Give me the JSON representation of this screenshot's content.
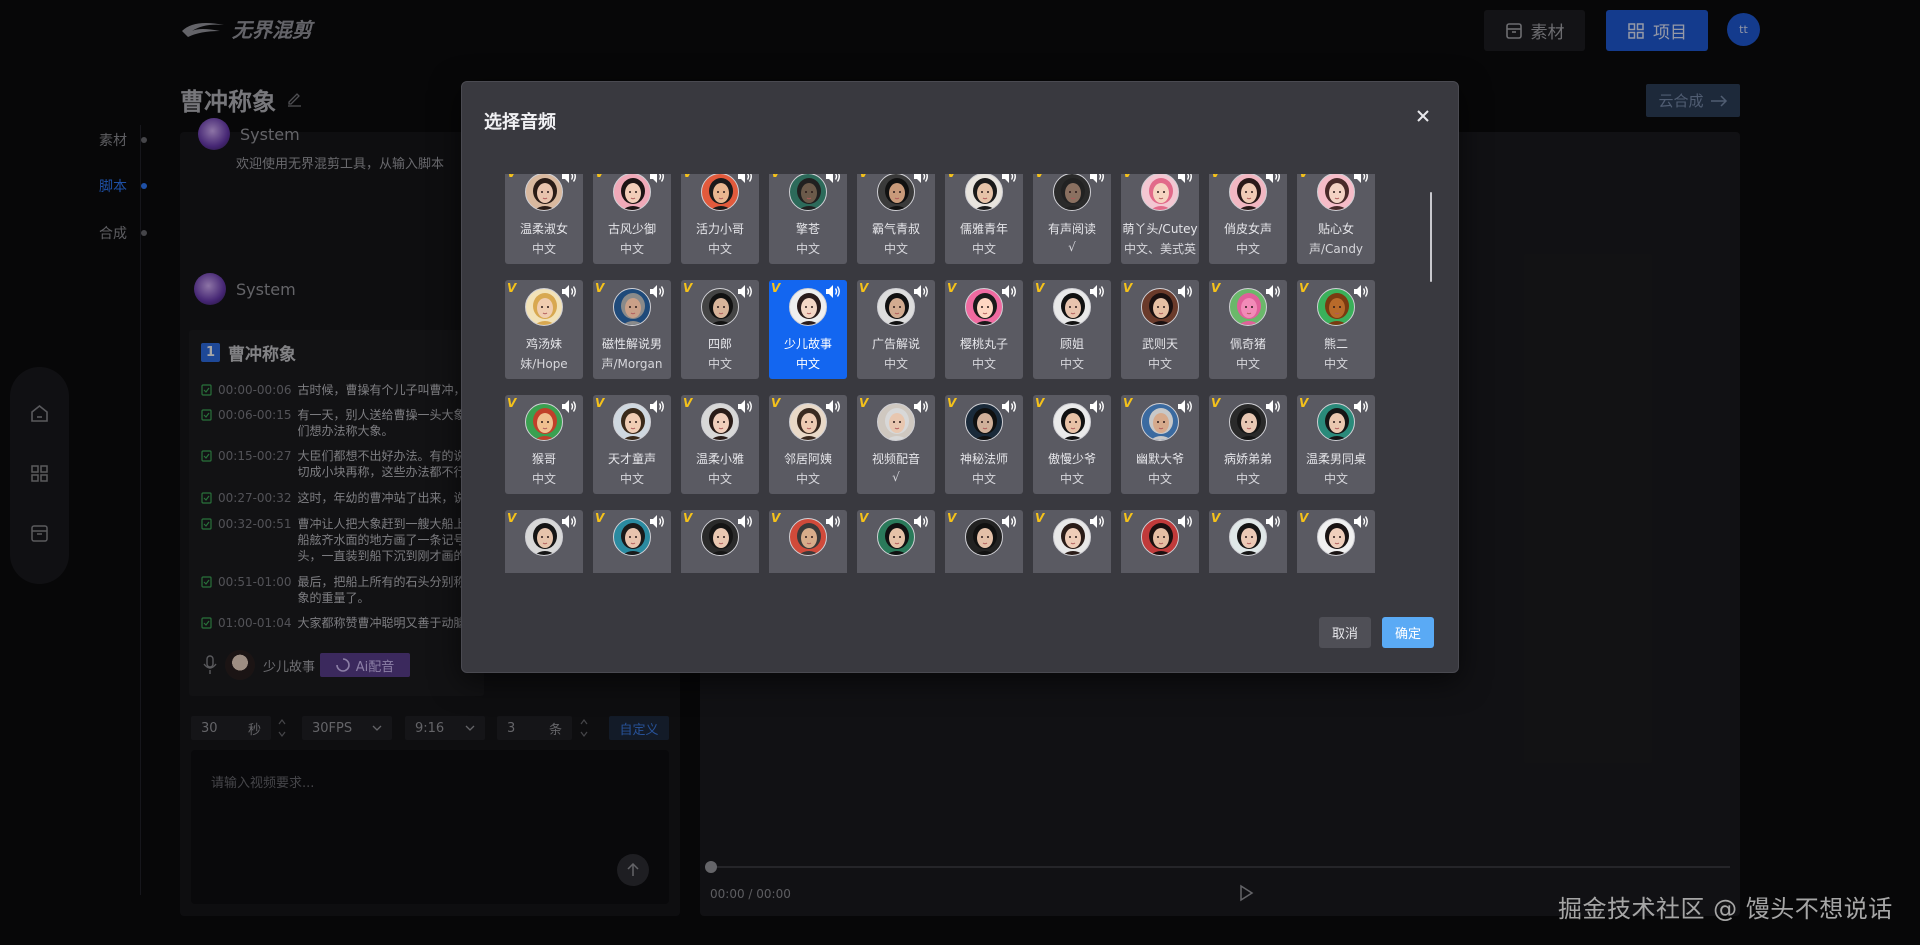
{
  "header": {
    "logo_text": "无界混剪",
    "material_label": "素材",
    "project_label": "项目",
    "avatar_text": "tt"
  },
  "page": {
    "title": "曹冲称象",
    "cloud_button": "云合成"
  },
  "steps": [
    "素材",
    "脚本",
    "合成"
  ],
  "chat": {
    "system_label": "System",
    "welcome": "欢迎使用无界混剪工具，从输入脚本",
    "system_label2": "System"
  },
  "script": {
    "index": "1",
    "title": "曹冲称象",
    "lines": [
      {
        "time": "00:00-00:06",
        "text": "古时候，曹操有个儿子叫曹冲，他"
      },
      {
        "time": "00:06-00:15",
        "text": "有一天，别人送给曹操一头大象。",
        "text2": "们想办法称大象。"
      },
      {
        "time": "00:15-00:27",
        "text": "大臣们都想不出好办法。有的说造",
        "text2": "切成小块再称，这些办法都不行。"
      },
      {
        "time": "00:27-00:32",
        "text": "这时，年幼的曹冲站了出来，说自"
      },
      {
        "time": "00:32-00:51",
        "text": "曹冲让人把大象赶到一艘大船上，",
        "text2": "船舷齐水面的地方画了一条记号。",
        "text3": "头，一直装到船下沉到刚才画的记"
      },
      {
        "time": "00:51-01:00",
        "text": "最后，把船上所有的石头分别称一",
        "text2": "象的重量了。"
      },
      {
        "time": "01:00-01:04",
        "text": "大家都称赞曹冲聪明又善于动脑筋"
      }
    ],
    "voice_name": "少儿故事",
    "ai_button": "Ai配音"
  },
  "controls": {
    "duration_value": "30",
    "duration_unit": "秒",
    "fps": "30FPS",
    "ratio": "9:16",
    "count_value": "3",
    "count_unit": "条",
    "custom": "自定义"
  },
  "request": {
    "placeholder": "请输入视频要求..."
  },
  "player": {
    "time": "00:00 / 00:00"
  },
  "watermark": "掘金技术社区 @ 馒头不想说话",
  "modal": {
    "title": "选择音频",
    "cancel": "取消",
    "confirm": "确定",
    "vip_badge": "V",
    "voices": [
      {
        "name": "温柔淑女",
        "lang": "中文",
        "skin": "#e9c4ad",
        "hair": "#2a1c16",
        "bg": "#d9b99f"
      },
      {
        "name": "古风少御",
        "lang": "中文",
        "skin": "#f2cdb8",
        "hair": "#1d1414",
        "bg": "#f0a9b8"
      },
      {
        "name": "活力小哥",
        "lang": "中文",
        "skin": "#e9b790",
        "hair": "#1a1a1a",
        "bg": "#e25a3c"
      },
      {
        "name": "擎苍",
        "lang": "中文",
        "skin": "#6b5a4a",
        "hair": "#202020",
        "bg": "#2c6a5a"
      },
      {
        "name": "霸气青叔",
        "lang": "中文",
        "skin": "#c99a7a",
        "hair": "#111111",
        "bg": "#3a3a3a"
      },
      {
        "name": "儒雅青年",
        "lang": "中文",
        "skin": "#e6c3a8",
        "hair": "#1a1a1a",
        "bg": "#e8e4de"
      },
      {
        "name": "有声阅读",
        "lang": "√",
        "skin": "#8a7060",
        "hair": "#222222",
        "bg": "#2a2a2a"
      },
      {
        "name": "萌丫头/Cutey",
        "lang": "中文、美式英",
        "skin": "#f6d4c2",
        "hair": "#e26a8a",
        "bg": "#f3c7d2"
      },
      {
        "name": "俏皮女声",
        "lang": "中文",
        "skin": "#f1cbb6",
        "hair": "#2a1a1a",
        "bg": "#f2b7c2"
      },
      {
        "name": "贴心女",
        "lang": "声/Candy",
        "skin": "#f4d2c4",
        "hair": "#4a2a2a",
        "bg": "#f6bcc8"
      },
      {
        "name": "鸡汤妹",
        "lang": "妹/Hope",
        "skin": "#f0cdb0",
        "hair": "#d8a850",
        "bg": "#f2e2b8"
      },
      {
        "name": "磁性解说男",
        "lang": "声/Morgan",
        "skin": "#caa088",
        "hair": "#8a8a8a",
        "bg": "#1f4a7a"
      },
      {
        "name": "四郎",
        "lang": "中文",
        "skin": "#d8b49a",
        "hair": "#111111",
        "bg": "#444444"
      },
      {
        "name": "少儿故事",
        "lang": "中文",
        "skin": "#f4d7c6",
        "hair": "#2a1c1c",
        "bg": "#efefef"
      },
      {
        "name": "广告解说",
        "lang": "中文",
        "skin": "#d2ab90",
        "hair": "#111111",
        "bg": "#dddddd"
      },
      {
        "name": "樱桃丸子",
        "lang": "中文",
        "skin": "#ffd6c2",
        "hair": "#1a1a1a",
        "bg": "#f06aa0"
      },
      {
        "name": "顾姐",
        "lang": "中文",
        "skin": "#e8c4ae",
        "hair": "#111111",
        "bg": "#e9e9e9"
      },
      {
        "name": "武则天",
        "lang": "中文",
        "skin": "#e7c0a4",
        "hair": "#1a1010",
        "bg": "#6a3a2a"
      },
      {
        "name": "佩奇猪",
        "lang": "中文",
        "skin": "#f28bb8",
        "hair": "#e0609a",
        "bg": "#6ab86a"
      },
      {
        "name": "熊二",
        "lang": "中文",
        "skin": "#b86a2a",
        "hair": "#7a3a10",
        "bg": "#3ab05a"
      },
      {
        "name": "猴哥",
        "lang": "中文",
        "skin": "#f0c090",
        "hair": "#c0402a",
        "bg": "#3aa050"
      },
      {
        "name": "天才童声",
        "lang": "中文",
        "skin": "#f0cdb4",
        "hair": "#3a2a1a",
        "bg": "#cfd8e0"
      },
      {
        "name": "温柔小雅",
        "lang": "中文",
        "skin": "#f1cfbc",
        "hair": "#2a1c18",
        "bg": "#d8d8d8"
      },
      {
        "name": "邻居阿姨",
        "lang": "中文",
        "skin": "#eecbb2",
        "hair": "#3a2a20",
        "bg": "#e9d9c8"
      },
      {
        "name": "视频配音",
        "lang": "√",
        "skin": "#e8c7b0",
        "hair": "#d8d8d8",
        "bg": "#cfc8c0"
      },
      {
        "name": "神秘法师",
        "lang": "中文",
        "skin": "#d0b09a",
        "hair": "#101010",
        "bg": "#1a2a3a"
      },
      {
        "name": "傲慢少爷",
        "lang": "中文",
        "skin": "#e8c2a6",
        "hair": "#111111",
        "bg": "#eaeaea"
      },
      {
        "name": "幽默大爷",
        "lang": "中文",
        "skin": "#d6aa8c",
        "hair": "#c8c8c8",
        "bg": "#3a6aa0"
      },
      {
        "name": "病娇弟弟",
        "lang": "中文",
        "skin": "#e8c8b4",
        "hair": "#151515",
        "bg": "#2a2a2a"
      },
      {
        "name": "温柔男同桌",
        "lang": "中文",
        "skin": "#eac8b0",
        "hair": "#151515",
        "bg": "#2a8a7a"
      },
      {
        "name": "",
        "lang": "",
        "skin": "#e6c4ac",
        "hair": "#151515",
        "bg": "#d8d8d8"
      },
      {
        "name": "",
        "lang": "",
        "skin": "#e8c4ae",
        "hair": "#1a1a1a",
        "bg": "#2a8aa0"
      },
      {
        "name": "",
        "lang": "",
        "skin": "#eac8b2",
        "hair": "#151515",
        "bg": "#2a2a2a"
      },
      {
        "name": "",
        "lang": "",
        "skin": "#d8ac8a",
        "hair": "#3a3a3a",
        "bg": "#d04a3a"
      },
      {
        "name": "",
        "lang": "",
        "skin": "#e6c2a8",
        "hair": "#111111",
        "bg": "#2a7a5a"
      },
      {
        "name": "",
        "lang": "",
        "skin": "#e4c0a8",
        "hair": "#111111",
        "bg": "#222222"
      },
      {
        "name": "",
        "lang": "",
        "skin": "#efcdb8",
        "hair": "#2a1c18",
        "bg": "#e8e8e8"
      },
      {
        "name": "",
        "lang": "",
        "skin": "#e6bea4",
        "hair": "#1a1010",
        "bg": "#c03a3a"
      },
      {
        "name": "",
        "lang": "",
        "skin": "#eccab6",
        "hair": "#151515",
        "bg": "#e0e8e8"
      },
      {
        "name": "",
        "lang": "",
        "skin": "#f0cfbc",
        "hair": "#1a1414",
        "bg": "#f0f0f0"
      }
    ],
    "selected_index": 13
  }
}
